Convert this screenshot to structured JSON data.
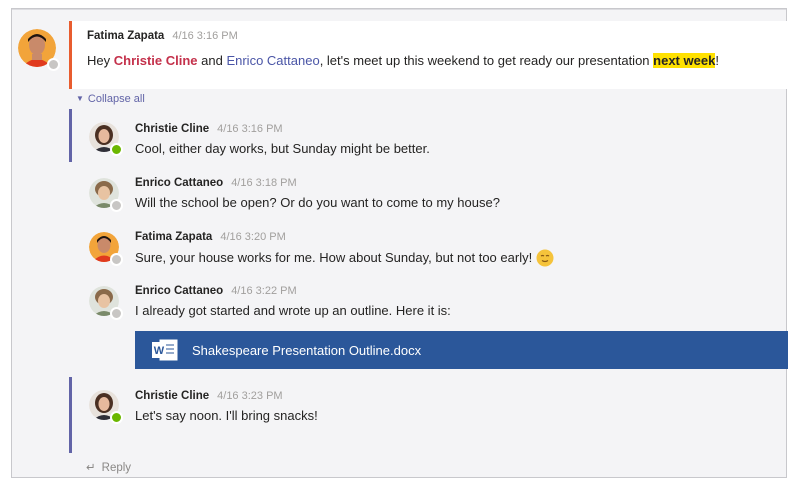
{
  "root_message": {
    "sender": "Fatima Zapata",
    "time": "4/16 3:16 PM",
    "text_hey": "Hey ",
    "mention_1": "Christie Cline",
    "text_and": " and ",
    "mention_2": "Enrico Cattaneo",
    "text_rest": ", let's meet up this weekend to get ready our presentation ",
    "highlight": "next week",
    "text_end": "!",
    "presence": "offline"
  },
  "collapse_label": "Collapse all",
  "replies": [
    {
      "sender": "Christie Cline",
      "time": "4/16 3:16 PM",
      "text": "Cool, either day works, but Sunday might be better.",
      "presence": "available"
    },
    {
      "sender": "Enrico Cattaneo",
      "time": "4/16 3:18 PM",
      "text": "Will the school be open? Or do you want to come to my house?",
      "presence": "offline"
    },
    {
      "sender": "Fatima Zapata",
      "time": "4/16 3:20 PM",
      "text": "Sure, your house works for me. How about Sunday, but not too early!",
      "presence": "offline",
      "emoji": "smiling-face-emoji"
    },
    {
      "sender": "Enrico Cattaneo",
      "time": "4/16 3:22 PM",
      "text": "I already got started and wrote up an outline. Here it is:",
      "presence": "offline"
    },
    {
      "sender": "Christie Cline",
      "time": "4/16 3:23 PM",
      "text": "Let's say noon. I'll bring snacks!",
      "presence": "available"
    }
  ],
  "attachment": {
    "file_name": "Shakespeare Presentation Outline.docx",
    "icon": "word-document-icon",
    "color": "#2b579a",
    "icon_letter": "W"
  },
  "reply_label": "Reply",
  "colors": {
    "accent": "#6264a7",
    "root_border": "#e85c2f",
    "mention_red": "#c4314b",
    "highlight": "#ffe100",
    "presence_available": "#6bb700",
    "presence_offline": "#c8c6c4"
  }
}
